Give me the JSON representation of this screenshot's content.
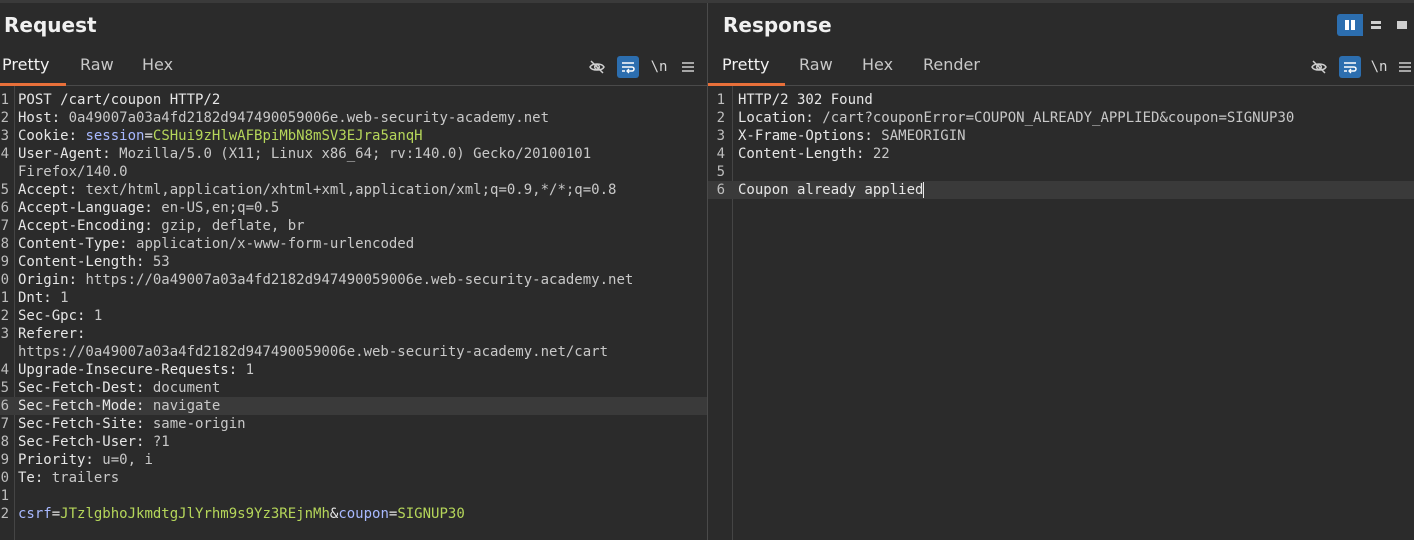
{
  "request": {
    "title": "Request",
    "tabs": [
      "Pretty",
      "Raw",
      "Hex"
    ],
    "active_tab": "Pretty",
    "lines": [
      {
        "num": "1",
        "parts": [
          {
            "t": "POST /cart/coupon HTTP/2",
            "c": "k"
          }
        ]
      },
      {
        "num": "2",
        "parts": [
          {
            "t": "Host: ",
            "c": "k"
          },
          {
            "t": "0a49007a03a4fd2182d947490059006e.web-security-academy.net",
            "c": "v"
          }
        ]
      },
      {
        "num": "3",
        "parts": [
          {
            "t": "Cookie: ",
            "c": "k"
          },
          {
            "t": "session",
            "c": "cookie-name"
          },
          {
            "t": "=",
            "c": "k"
          },
          {
            "t": "CSHui9zHlwAFBpiMbN8mSV3EJra5anqH",
            "c": "cookie-val"
          }
        ]
      },
      {
        "num": "4",
        "parts": [
          {
            "t": "User-Agent: ",
            "c": "k"
          },
          {
            "t": "Mozilla/5.0 (X11; Linux x86_64; rv:140.0) Gecko/20100101",
            "c": "v"
          }
        ]
      },
      {
        "num": "",
        "parts": [
          {
            "t": "Firefox/140.0",
            "c": "v"
          }
        ]
      },
      {
        "num": "5",
        "parts": [
          {
            "t": "Accept: ",
            "c": "k"
          },
          {
            "t": "text/html,application/xhtml+xml,application/xml;q=0.9,*/*;q=0.8",
            "c": "v"
          }
        ]
      },
      {
        "num": "6",
        "parts": [
          {
            "t": "Accept-Language: ",
            "c": "k"
          },
          {
            "t": "en-US,en;q=0.5",
            "c": "v"
          }
        ]
      },
      {
        "num": "7",
        "parts": [
          {
            "t": "Accept-Encoding: ",
            "c": "k"
          },
          {
            "t": "gzip, deflate, br",
            "c": "v"
          }
        ]
      },
      {
        "num": "8",
        "parts": [
          {
            "t": "Content-Type: ",
            "c": "k"
          },
          {
            "t": "application/x-www-form-urlencoded",
            "c": "v"
          }
        ]
      },
      {
        "num": "9",
        "parts": [
          {
            "t": "Content-Length: ",
            "c": "k"
          },
          {
            "t": "53",
            "c": "v"
          }
        ]
      },
      {
        "num": "0",
        "parts": [
          {
            "t": "Origin: ",
            "c": "k"
          },
          {
            "t": "https://0a49007a03a4fd2182d947490059006e.web-security-academy.net",
            "c": "v"
          }
        ]
      },
      {
        "num": "1",
        "parts": [
          {
            "t": "Dnt: ",
            "c": "k"
          },
          {
            "t": "1",
            "c": "v"
          }
        ]
      },
      {
        "num": "2",
        "parts": [
          {
            "t": "Sec-Gpc: ",
            "c": "k"
          },
          {
            "t": "1",
            "c": "v"
          }
        ]
      },
      {
        "num": "3",
        "parts": [
          {
            "t": "Referer: ",
            "c": "k"
          }
        ]
      },
      {
        "num": "",
        "parts": [
          {
            "t": "https://0a49007a03a4fd2182d947490059006e.web-security-academy.net/cart",
            "c": "v"
          }
        ]
      },
      {
        "num": "4",
        "parts": [
          {
            "t": "Upgrade-Insecure-Requests: ",
            "c": "k"
          },
          {
            "t": "1",
            "c": "v"
          }
        ]
      },
      {
        "num": "5",
        "parts": [
          {
            "t": "Sec-Fetch-Dest: ",
            "c": "k"
          },
          {
            "t": "document",
            "c": "v"
          }
        ]
      },
      {
        "num": "6",
        "highlight": true,
        "parts": [
          {
            "t": "Sec-Fetch-Mode: ",
            "c": "k"
          },
          {
            "t": "navigate",
            "c": "v"
          }
        ]
      },
      {
        "num": "7",
        "parts": [
          {
            "t": "Sec-Fetch-Site: ",
            "c": "k"
          },
          {
            "t": "same-origin",
            "c": "v"
          }
        ]
      },
      {
        "num": "8",
        "parts": [
          {
            "t": "Sec-Fetch-User: ",
            "c": "k"
          },
          {
            "t": "?1",
            "c": "v"
          }
        ]
      },
      {
        "num": "9",
        "parts": [
          {
            "t": "Priority: ",
            "c": "k"
          },
          {
            "t": "u=0, i",
            "c": "v"
          }
        ]
      },
      {
        "num": "0",
        "parts": [
          {
            "t": "Te: ",
            "c": "k"
          },
          {
            "t": "trailers",
            "c": "v"
          }
        ]
      },
      {
        "num": "1",
        "parts": []
      },
      {
        "num": "2",
        "parts": [
          {
            "t": "csrf",
            "c": "cookie-name"
          },
          {
            "t": "=",
            "c": "k"
          },
          {
            "t": "JTzlgbhoJkmdtgJlYrhm9s9Yz3REjnMh",
            "c": "cookie-val"
          },
          {
            "t": "&",
            "c": "k"
          },
          {
            "t": "coupon",
            "c": "cookie-name"
          },
          {
            "t": "=",
            "c": "k"
          },
          {
            "t": "SIGNUP30",
            "c": "cookie-val"
          }
        ]
      }
    ]
  },
  "response": {
    "title": "Response",
    "tabs": [
      "Pretty",
      "Raw",
      "Hex",
      "Render"
    ],
    "active_tab": "Pretty",
    "lines": [
      {
        "num": "1",
        "parts": [
          {
            "t": "HTTP/2 302 Found",
            "c": "k"
          }
        ]
      },
      {
        "num": "2",
        "parts": [
          {
            "t": "Location: ",
            "c": "k"
          },
          {
            "t": "/cart?couponError=COUPON_ALREADY_APPLIED&coupon=SIGNUP30",
            "c": "v"
          }
        ]
      },
      {
        "num": "3",
        "parts": [
          {
            "t": "X-Frame-Options: ",
            "c": "k"
          },
          {
            "t": "SAMEORIGIN",
            "c": "v"
          }
        ]
      },
      {
        "num": "4",
        "parts": [
          {
            "t": "Content-Length: ",
            "c": "k"
          },
          {
            "t": "22",
            "c": "v"
          }
        ]
      },
      {
        "num": "5",
        "parts": []
      },
      {
        "num": "6",
        "highlight": true,
        "caret": true,
        "parts": [
          {
            "t": "Coupon already applied",
            "c": "k"
          }
        ]
      }
    ]
  },
  "toolbar": {
    "newline_label": "\\n"
  },
  "colors": {
    "accent_tab": "#e8703a",
    "toggle_on": "#2c6eaf",
    "param_name": "#a8b9ff",
    "param_value": "#b5d65a"
  },
  "icons": [
    "hide-icon",
    "wrap-icon",
    "newline-icon",
    "menu-icon",
    "layout-split-icon",
    "layout-stack-icon",
    "layout-single-icon"
  ]
}
